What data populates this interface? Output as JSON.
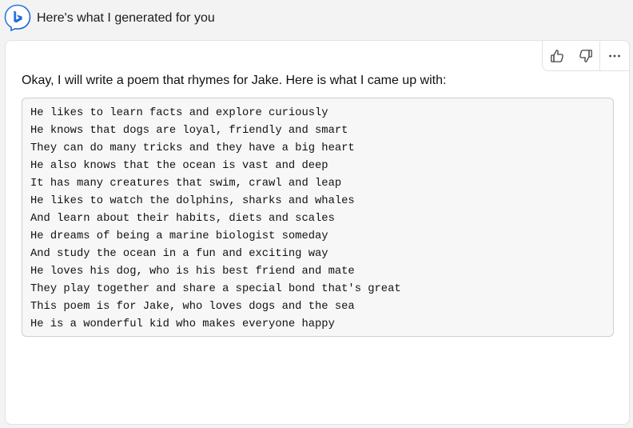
{
  "header": {
    "title": "Here's what I generated for you",
    "logo_icon": "bing-logo-icon",
    "logo_color": "#1a6ce0"
  },
  "card": {
    "actions": [
      {
        "name": "thumbs-up-icon",
        "label": "Like"
      },
      {
        "name": "thumbs-down-icon",
        "label": "Dislike"
      },
      {
        "name": "more-options-icon",
        "label": "More"
      }
    ],
    "intro": "Okay, I will write a poem that rhymes for Jake. Here is what I came up with:",
    "poem_lines": [
      "He likes to learn facts and explore curiously",
      "He knows that dogs are loyal, friendly and smart",
      "They can do many tricks and they have a big heart",
      "He also knows that the ocean is vast and deep",
      "It has many creatures that swim, crawl and leap",
      "He likes to watch the dolphins, sharks and whales",
      "And learn about their habits, diets and scales",
      "He dreams of being a marine biologist someday",
      "And study the ocean in a fun and exciting way",
      "He loves his dog, who is his best friend and mate",
      "They play together and share a special bond that's great",
      "This poem is for Jake, who loves dogs and the sea",
      "He is a wonderful kid who makes everyone happy"
    ]
  }
}
